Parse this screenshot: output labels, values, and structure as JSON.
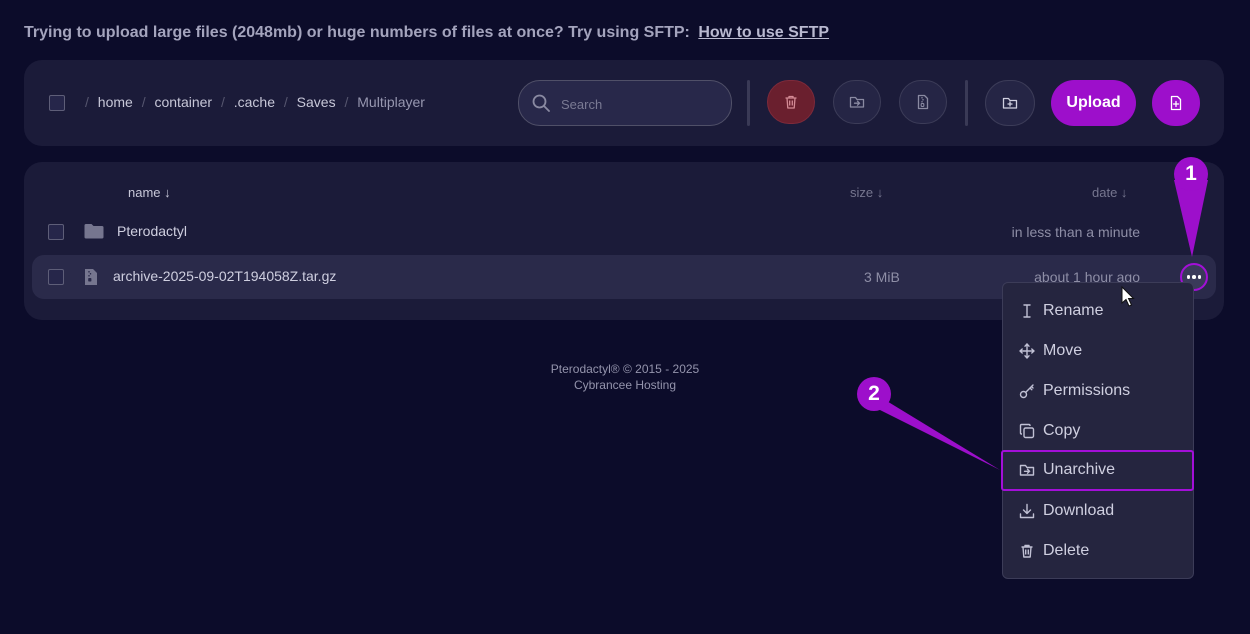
{
  "notice": {
    "text": "Trying to upload large files (2048mb) or huge numbers of files at once? Try using SFTP:",
    "link": "How to use SFTP"
  },
  "breadcrumb": {
    "separator": "/",
    "segments": [
      "home",
      "container",
      ".cache",
      "Saves"
    ],
    "current": "Multiplayer"
  },
  "search": {
    "placeholder": "Search"
  },
  "toolbar": {
    "upload_label": "Upload",
    "icons": [
      "trash-icon",
      "move-icon",
      "archive-icon",
      "new-folder-icon",
      "new-file-icon"
    ]
  },
  "file_list": {
    "columns": {
      "name": "name ↓",
      "size": "size ↓",
      "date": "date ↓"
    },
    "rows": [
      {
        "name": "Pterodactyl",
        "size": "",
        "date": "in less than a minute",
        "type": "folder"
      },
      {
        "name": "archive-2025-09-02T194058Z.tar.gz",
        "size": "3 MiB",
        "date": "about 1 hour ago",
        "type": "file"
      }
    ]
  },
  "context_menu": {
    "items": [
      "Rename",
      "Move",
      "Permissions",
      "Copy",
      "Unarchive",
      "Download",
      "Delete"
    ],
    "highlighted": "Unarchive"
  },
  "footer": {
    "line1": "Pterodactyl® © 2015 - 2025",
    "line2": "Cybrancee Hosting"
  },
  "annotations": {
    "step1": "1",
    "step2": "2"
  },
  "colors": {
    "background": "#0c0c2a",
    "panel": "#1b1b39",
    "accent": "#9d0fcb",
    "danger": "#6a1f2e"
  }
}
